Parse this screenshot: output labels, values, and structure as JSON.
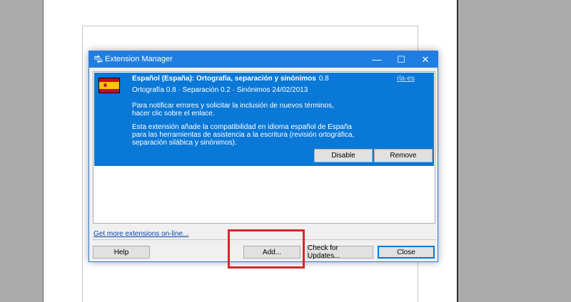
{
  "dialog": {
    "title": "Extension Manager",
    "window_controls": {
      "minimize": "—",
      "maximize": "☐",
      "close": "✕"
    }
  },
  "extension": {
    "name": "Español (España): Ortografía, separación y sinónimos",
    "version": "0.8",
    "link": "rla-es",
    "subtitle": "Ortografía 0.8 · Separación 0.2 · Sinónimos 24/02/2013",
    "desc_line1": "Para notificar errores y solicitar la inclusión de nuevos términos,",
    "desc_line2": "hacer clic sobre el enlace.",
    "desc_line3": "Esta extensión añade la compatibilidad en idioma español de España",
    "desc_line4": "para las herramientas de asistencia a la escritura (revisión ortográfica,",
    "desc_line5": "separación silábica y sinónimos).",
    "disable_label": "Disable",
    "remove_label": "Remove",
    "flag_colors": {
      "red": "#c60b1e",
      "yellow": "#ffc400"
    }
  },
  "footer": {
    "get_more": "Get more extensions on-line...",
    "help_label": "Help",
    "add_label": "Add...",
    "check_updates_label": "Check for Updates...",
    "close_label": "Close"
  },
  "colors": {
    "titlebar": "#1f7ee0",
    "selection": "#0a78d7",
    "highlight": "#d62828"
  }
}
